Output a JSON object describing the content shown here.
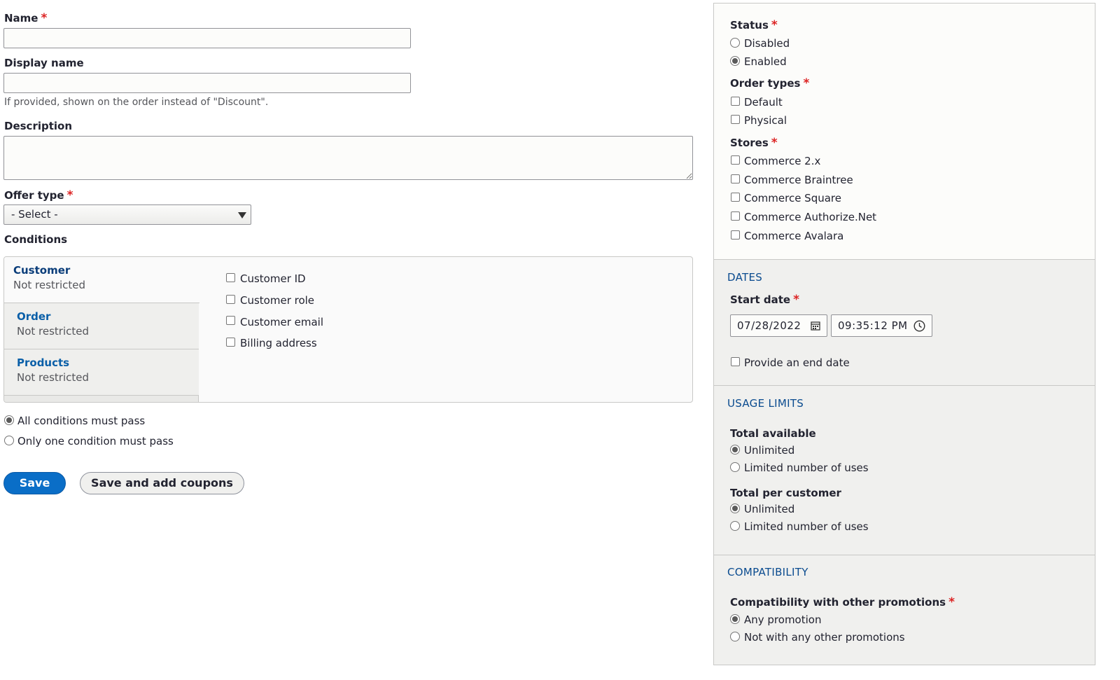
{
  "form": {
    "name": {
      "label": "Name",
      "required_mark": "*",
      "value": ""
    },
    "display_name": {
      "label": "Display name",
      "value": "",
      "help": "If provided, shown on the order instead of \"Discount\"."
    },
    "description": {
      "label": "Description",
      "value": ""
    },
    "offer_type": {
      "label": "Offer type",
      "required_mark": "*",
      "selected": "- Select -"
    },
    "conditions": {
      "label": "Conditions",
      "tabs": [
        {
          "title": "Customer",
          "summary": "Not restricted",
          "active": true
        },
        {
          "title": "Order",
          "summary": "Not restricted",
          "active": false
        },
        {
          "title": "Products",
          "summary": "Not restricted",
          "active": false
        }
      ],
      "options": [
        "Customer ID",
        "Customer role",
        "Customer email",
        "Billing address"
      ],
      "operator": [
        {
          "label": "All conditions must pass",
          "checked": true
        },
        {
          "label": "Only one condition must pass",
          "checked": false
        }
      ]
    },
    "actions": {
      "save": "Save",
      "save_add": "Save and add coupons"
    }
  },
  "sidebar": {
    "status": {
      "label": "Status",
      "required_mark": "*",
      "options": [
        {
          "label": "Disabled",
          "checked": false
        },
        {
          "label": "Enabled",
          "checked": true
        }
      ]
    },
    "order_types": {
      "label": "Order types",
      "required_mark": "*",
      "options": [
        "Default",
        "Physical"
      ]
    },
    "stores": {
      "label": "Stores",
      "required_mark": "*",
      "options": [
        "Commerce 2.x",
        "Commerce Braintree",
        "Commerce Square",
        "Commerce Authorize.Net",
        "Commerce Avalara"
      ]
    },
    "dates": {
      "heading": "DATES",
      "start_label": "Start date",
      "required_mark": "*",
      "date": "07/28/2022",
      "time": "09:35:12 PM",
      "end_option": "Provide an end date"
    },
    "usage": {
      "heading": "USAGE LIMITS",
      "total": {
        "label": "Total available",
        "options": [
          {
            "label": "Unlimited",
            "checked": true
          },
          {
            "label": "Limited number of uses",
            "checked": false
          }
        ]
      },
      "per_customer": {
        "label": "Total per customer",
        "options": [
          {
            "label": "Unlimited",
            "checked": true
          },
          {
            "label": "Limited number of uses",
            "checked": false
          }
        ]
      }
    },
    "compat": {
      "heading": "COMPATIBILITY",
      "label": "Compatibility with other promotions",
      "required_mark": "*",
      "options": [
        {
          "label": "Any promotion",
          "checked": true
        },
        {
          "label": "Not with any other promotions",
          "checked": false
        }
      ]
    }
  }
}
